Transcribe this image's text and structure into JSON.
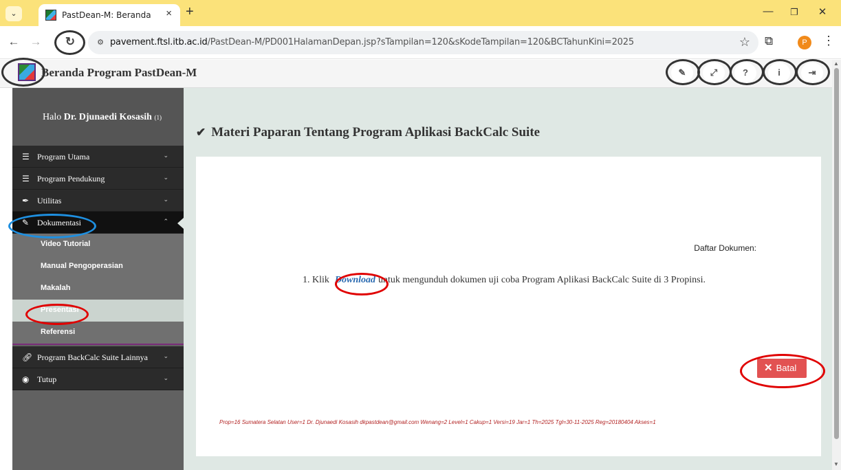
{
  "browser": {
    "tab_title": "PastDean-M: Beranda",
    "tab_close": "×",
    "new_tab": "+",
    "url_domain": "pavement.ftsl.itb.ac.id",
    "url_path": "/PastDean-M/PD001HalamanDepan.jsp?sTampilan=120&sKodeTampilan=120&BCTahunKini=2025",
    "profile_initial": "P",
    "icons": [
      "tab-search-icon",
      "back-arrow-icon",
      "forward-arrow-icon",
      "reload-icon",
      "site-info-icon",
      "star-icon",
      "extensions-icon",
      "more-menu-icon",
      "minimize-icon",
      "restore-icon",
      "close-icon"
    ]
  },
  "header": {
    "title": "Beranda Program PastDean-M",
    "buttons": [
      "pencil-icon",
      "expand-icon",
      "help-icon",
      "info-icon",
      "logout-icon"
    ]
  },
  "sidebar": {
    "greeting_prefix": "Halo ",
    "user_name": "Dr. Djunaedi Kosasih",
    "user_id": "(1)",
    "items": [
      {
        "label": "Program Utama",
        "icon": "list-icon"
      },
      {
        "label": "Program Pendukung",
        "icon": "list-icon"
      },
      {
        "label": "Utilitas",
        "icon": "quill-icon"
      },
      {
        "label": "Dokumentasi",
        "icon": "pencil-icon"
      }
    ],
    "submenu": [
      "Video Tutorial",
      "Manual Pengoperasian",
      "Makalah",
      "Presentasi",
      "Referensi"
    ],
    "items_after": [
      {
        "label": "Program BackCalc Suite Lainnya",
        "icon": "link-icon"
      },
      {
        "label": "Tutup",
        "icon": "stop-icon"
      }
    ]
  },
  "main": {
    "title": "Materi Paparan Tentang Program Aplikasi BackCalc Suite",
    "doc_header": "Daftar Dokumen:",
    "doc_number": "1.",
    "doc_prefix": "Klik",
    "doc_link": "Download",
    "doc_suffix": "untuk mengunduh dokumen uji coba Program Aplikasi BackCalc Suite di 3 Propinsi.",
    "cancel_label": "Batal",
    "footer_info": "Prop=16 Sumatera Selatan  User=1 Dr. Djunaedi Kosasih dkpastdean@gmail.com  Wenang=2  Level=1  Cakup=1  Versi=19  Jar=1  Th=2025  Tgl=30-11-2025  Reg=20180404  Akses=1"
  },
  "colors": {
    "tabbar": "#fbe27a",
    "sidebar_dark": "#2b2b2b",
    "main_bg": "#dfe8e4",
    "cancel_btn": "#e25252",
    "link": "#2a6ab0",
    "annotation_red": "#e00000",
    "annotation_blue": "#1e8fe0",
    "annotation_gray": "#333333"
  }
}
